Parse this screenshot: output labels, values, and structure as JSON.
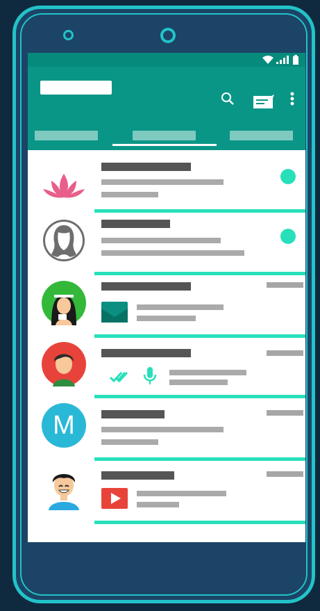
{
  "app": {
    "title": "",
    "colors": {
      "primary": "#0a9686",
      "status": "#068a7b",
      "accent": "#27e0ba",
      "frame": "#22c3c9",
      "phone": "#1c4466",
      "background": "#0f2a3e"
    }
  },
  "toolbar": {
    "icons": [
      "search-icon",
      "new-chat-icon",
      "overflow-menu-icon"
    ]
  },
  "tabs": [
    {
      "label": "",
      "selected": false
    },
    {
      "label": "",
      "selected": true
    },
    {
      "label": "",
      "selected": false
    }
  ],
  "chats": [
    {
      "avatar": "lotus-avatar",
      "name": "",
      "preview": "",
      "time": "",
      "unread": true,
      "attachment": ""
    },
    {
      "avatar": "woman-silhouette-avatar",
      "name": "",
      "preview": "",
      "time": "",
      "unread": true,
      "attachment": ""
    },
    {
      "avatar": "girl-headband-avatar",
      "name": "",
      "preview": "",
      "time": "",
      "unread": false,
      "attachment": "image-icon"
    },
    {
      "avatar": "boy-avatar",
      "name": "",
      "preview": "",
      "time": "",
      "unread": false,
      "attachment": "double-check-mic-icon"
    },
    {
      "avatar": "letter-avatar",
      "initial": "M",
      "name": "",
      "preview": "",
      "time": "",
      "unread": false,
      "attachment": ""
    },
    {
      "avatar": "smiling-man-avatar",
      "name": "",
      "preview": "",
      "time": "",
      "unread": false,
      "attachment": "video-play-icon"
    }
  ]
}
